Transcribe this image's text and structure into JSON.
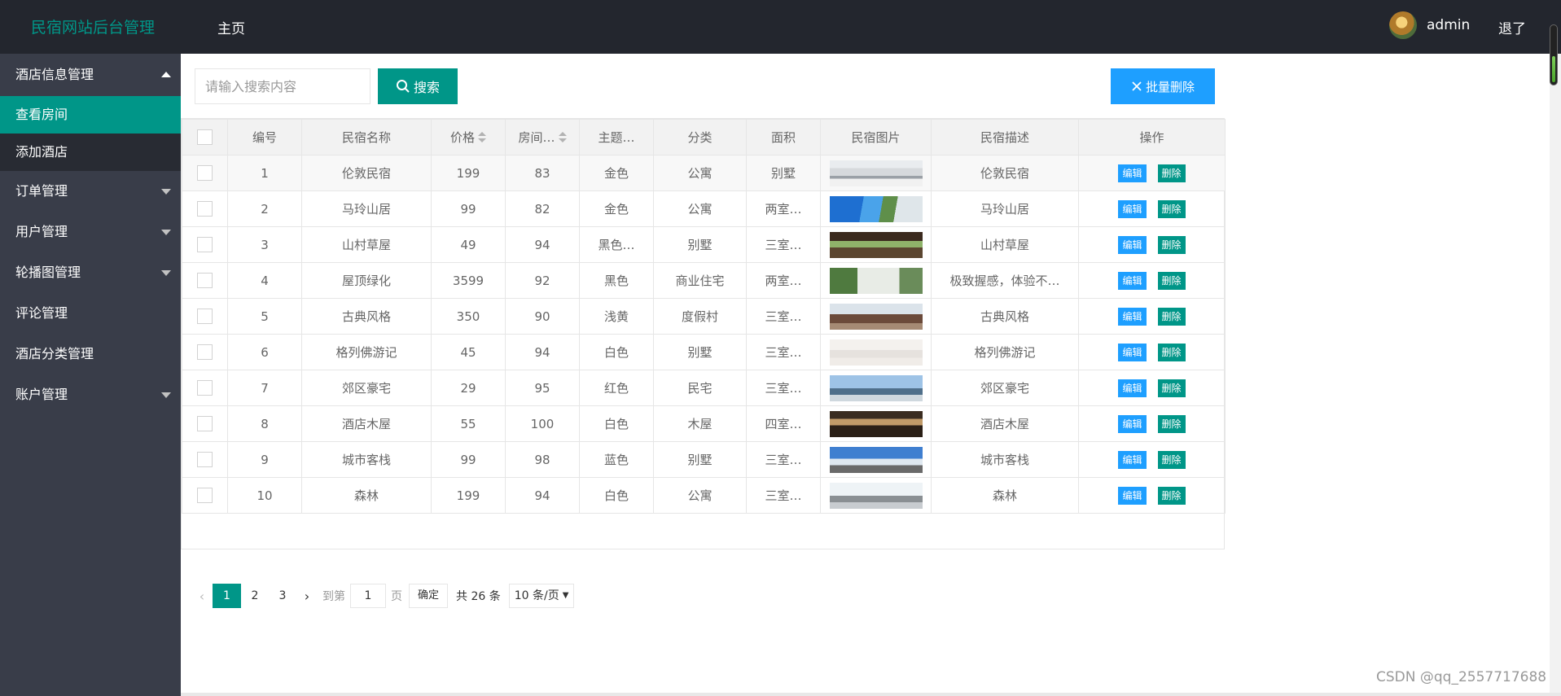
{
  "header": {
    "title": "民宿网站后台管理",
    "nav_home": "主页",
    "username": "admin",
    "logout": "退了"
  },
  "sidebar": {
    "groups": [
      {
        "label": "酒店信息管理",
        "expanded": true,
        "items": [
          {
            "label": "查看房间",
            "active": true
          },
          {
            "label": "添加酒店",
            "active": false
          }
        ]
      },
      {
        "label": "订单管理"
      },
      {
        "label": "用户管理"
      },
      {
        "label": "轮播图管理"
      },
      {
        "label": "评论管理"
      },
      {
        "label": "酒店分类管理"
      },
      {
        "label": "账户管理"
      }
    ]
  },
  "toolbar": {
    "search_placeholder": "请输入搜索内容",
    "search_label": "搜索",
    "batch_delete_label": "批量删除"
  },
  "table": {
    "columns": [
      "编号",
      "民宿名称",
      "价格",
      "房间…",
      "主题…",
      "分类",
      "面积",
      "民宿图片",
      "民宿描述",
      "操作"
    ],
    "edit_label": "编辑",
    "delete_label": "删除",
    "rows": [
      {
        "id": "1",
        "name": "伦敦民宿",
        "price": "199",
        "rooms": "83",
        "theme": "金色",
        "category": "公寓",
        "area": "别墅",
        "desc": "伦敦民宿"
      },
      {
        "id": "2",
        "name": "马玲山居",
        "price": "99",
        "rooms": "82",
        "theme": "金色",
        "category": "公寓",
        "area": "两室…",
        "desc": "马玲山居"
      },
      {
        "id": "3",
        "name": "山村草屋",
        "price": "49",
        "rooms": "94",
        "theme": "黑色…",
        "category": "别墅",
        "area": "三室…",
        "desc": "山村草屋"
      },
      {
        "id": "4",
        "name": "屋顶绿化",
        "price": "3599",
        "rooms": "92",
        "theme": "黑色",
        "category": "商业住宅",
        "area": "两室…",
        "desc": "极致握感，体验不…"
      },
      {
        "id": "5",
        "name": "古典风格",
        "price": "350",
        "rooms": "90",
        "theme": "浅黄",
        "category": "度假村",
        "area": "三室…",
        "desc": "古典风格"
      },
      {
        "id": "6",
        "name": "格列佛游记",
        "price": "45",
        "rooms": "94",
        "theme": "白色",
        "category": "别墅",
        "area": "三室…",
        "desc": "格列佛游记"
      },
      {
        "id": "7",
        "name": "郊区豪宅",
        "price": "29",
        "rooms": "95",
        "theme": "红色",
        "category": "民宅",
        "area": "三室…",
        "desc": "郊区豪宅"
      },
      {
        "id": "8",
        "name": "酒店木屋",
        "price": "55",
        "rooms": "100",
        "theme": "白色",
        "category": "木屋",
        "area": "四室…",
        "desc": "酒店木屋"
      },
      {
        "id": "9",
        "name": "城市客栈",
        "price": "99",
        "rooms": "98",
        "theme": "蓝色",
        "category": "别墅",
        "area": "三室…",
        "desc": "城市客栈"
      },
      {
        "id": "10",
        "name": "森林",
        "price": "199",
        "rooms": "94",
        "theme": "白色",
        "category": "公寓",
        "area": "三室…",
        "desc": "森林"
      }
    ]
  },
  "pagination": {
    "pages": [
      "1",
      "2",
      "3"
    ],
    "current": "1",
    "goto_label": "到第",
    "goto_value": "1",
    "page_label": "页",
    "confirm_label": "确定",
    "total_label": "共 26 条",
    "page_size": "10 条/页"
  },
  "watermark": "CSDN @qq_2557717688",
  "colors": {
    "header_bg": "#23262e",
    "sidebar_bg": "#393d49",
    "accent": "#009688",
    "primary": "#1e9fff"
  }
}
